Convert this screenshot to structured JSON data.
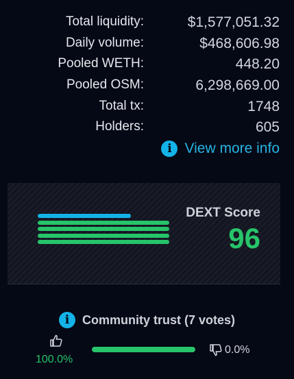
{
  "stats": [
    {
      "label": "Total liquidity:",
      "value": "$1,577,051.32"
    },
    {
      "label": "Daily volume:",
      "value": "$468,606.98"
    },
    {
      "label": "Pooled WETH:",
      "value": "448.20"
    },
    {
      "label": "Pooled OSM:",
      "value": "6,298,669.00"
    },
    {
      "label": "Total tx:",
      "value": "1748"
    },
    {
      "label": "Holders:",
      "value": "605"
    }
  ],
  "more_info": {
    "label": "View more info",
    "icon": "info-icon"
  },
  "dext_score": {
    "title": "DEXT Score",
    "value": "96",
    "bars": [
      {
        "fill": 0.71,
        "color": "#13b3e8"
      },
      {
        "fill": 1.0,
        "color": "#27c46a"
      },
      {
        "fill": 1.0,
        "color": "#27c46a"
      },
      {
        "fill": 1.0,
        "color": "#27c46a"
      },
      {
        "fill": 1.0,
        "color": "#27c46a"
      }
    ]
  },
  "community_trust": {
    "title": "Community trust (7 votes)",
    "up_pct": "100.0%",
    "down_pct": "0.0%",
    "up_fraction": 1.0,
    "bar_color": "#27c46a"
  },
  "colors": {
    "background": "#050815",
    "accent": "#13b3e8",
    "positive": "#27c46a"
  }
}
